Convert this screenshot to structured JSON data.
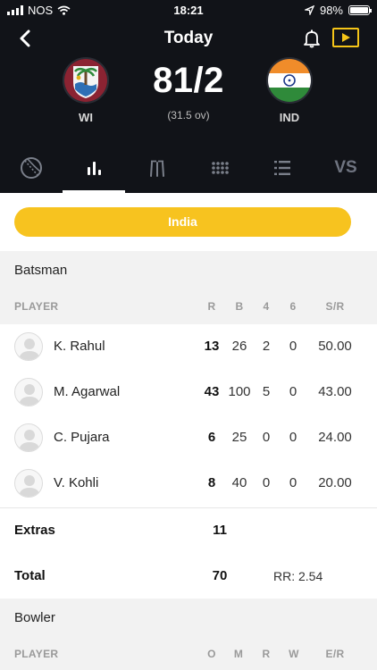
{
  "status_bar": {
    "carrier": "NOS",
    "time": "18:21",
    "battery": "98%",
    "battery_level": 0.98
  },
  "header": {
    "title": "Today"
  },
  "match": {
    "home": {
      "code": "WI",
      "icon": "west-indies-crest"
    },
    "away": {
      "code": "IND",
      "icon": "india-flag"
    },
    "score": "81/2",
    "overs": "(31.5 ov)"
  },
  "tabs": [
    {
      "icon": "cricket-ball-icon",
      "active": false
    },
    {
      "icon": "bar-chart-icon",
      "active": true
    },
    {
      "icon": "wickets-icon",
      "active": false
    },
    {
      "icon": "dot-grid-icon",
      "active": false
    },
    {
      "icon": "numbered-list-icon",
      "active": false
    },
    {
      "label": "VS",
      "active": false
    }
  ],
  "team_button": {
    "label": "India"
  },
  "batsman": {
    "title": "Batsman",
    "headers": {
      "player": "PLAYER",
      "r": "R",
      "b": "B",
      "fours": "4",
      "sixes": "6",
      "sr": "S/R"
    },
    "rows": [
      {
        "name": "K. Rahul",
        "r": "13",
        "b": "26",
        "fours": "2",
        "sixes": "0",
        "sr": "50.00"
      },
      {
        "name": "M. Agarwal",
        "r": "43",
        "b": "100",
        "fours": "5",
        "sixes": "0",
        "sr": "43.00"
      },
      {
        "name": "C. Pujara",
        "r": "6",
        "b": "25",
        "fours": "0",
        "sixes": "0",
        "sr": "24.00"
      },
      {
        "name": "V. Kohli",
        "r": "8",
        "b": "40",
        "fours": "0",
        "sixes": "0",
        "sr": "20.00"
      }
    ],
    "extras": {
      "label": "Extras",
      "value": "11"
    },
    "total": {
      "label": "Total",
      "value": "70",
      "run_rate": "RR: 2.54"
    }
  },
  "bowler": {
    "title": "Bowler",
    "headers": {
      "player": "PLAYER",
      "o": "O",
      "m": "M",
      "r": "R",
      "w": "W",
      "er": "E/R"
    }
  },
  "colors": {
    "accent": "#f7c31f",
    "header_bg": "#111318",
    "section_bg": "#f2f2f2"
  }
}
